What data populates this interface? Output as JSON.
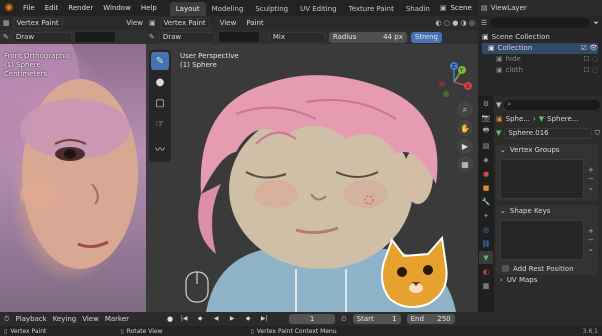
{
  "app": {
    "accent": "#4772b3",
    "version": "3.6.1"
  },
  "menu": [
    "File",
    "Edit",
    "Render",
    "Window",
    "Help"
  ],
  "workspaces": [
    "Layout",
    "Modeling",
    "Sculpting",
    "UV Editing",
    "Texture Paint",
    "Shadin"
  ],
  "scene": {
    "label": "Scene",
    "view_layer": "ViewLayer"
  },
  "left_editor": {
    "mode": "Vertex Paint",
    "view_label": "View",
    "brush": "Draw",
    "overlay_lines": [
      "Front Orthographic",
      "(1) Sphere",
      "Centimeters"
    ]
  },
  "viewport": {
    "mode": "Vertex Paint",
    "view_label": "View",
    "paint_label": "Paint",
    "brush": "Draw",
    "blend": "Mix",
    "radius_label": "Radius",
    "radius_value": "44 px",
    "strength_label": "Streng",
    "perspective": "User Perspective",
    "object": "(1) Sphere",
    "axes": [
      "X",
      "Y",
      "Z"
    ]
  },
  "outliner": {
    "root": "Scene Collection",
    "items": [
      {
        "name": "Collection",
        "level": 1
      },
      {
        "name": "hide",
        "level": 2
      },
      {
        "name": "cloth",
        "level": 2
      }
    ]
  },
  "properties": {
    "object_name": "Sphe...",
    "object_name_2": "Sphere...",
    "data_name": "Sphere.016",
    "sections": [
      "Vertex Groups",
      "Shape Keys"
    ],
    "rest_position": "Add Rest Position",
    "uv_maps": "UV Maps"
  },
  "timeline": {
    "playback": "Playback",
    "keying": "Keying",
    "view": "View",
    "marker": "Marker",
    "current_frame": "1",
    "start_label": "Start",
    "start": "1",
    "end_label": "End",
    "end": "250"
  },
  "status": {
    "left": "Vertex Paint",
    "middle": "Rotate View",
    "right": "Vertex Paint Context Menu"
  }
}
